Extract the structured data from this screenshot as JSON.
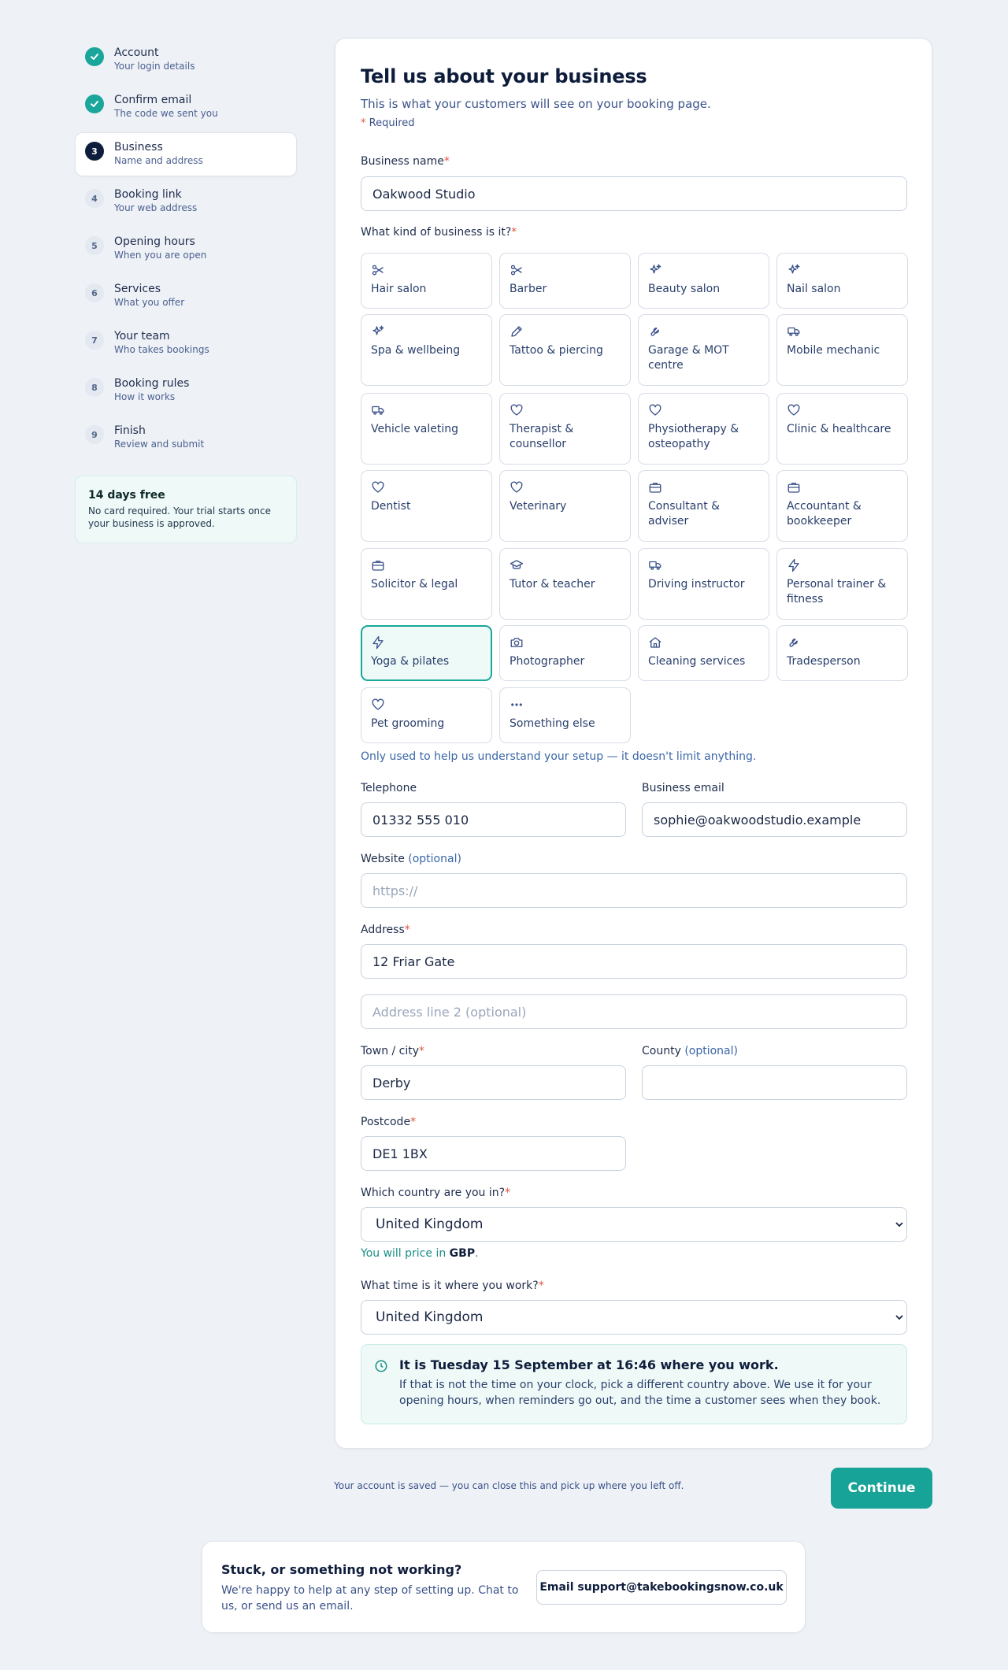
{
  "steps": [
    {
      "num": "",
      "title": "Account",
      "sub": "Your login details",
      "state": "done"
    },
    {
      "num": "",
      "title": "Confirm email",
      "sub": "The code we sent you",
      "state": "done"
    },
    {
      "num": "3",
      "title": "Business",
      "sub": "Name and address",
      "state": "current"
    },
    {
      "num": "4",
      "title": "Booking link",
      "sub": "Your web address",
      "state": "todo"
    },
    {
      "num": "5",
      "title": "Opening hours",
      "sub": "When you are open",
      "state": "todo"
    },
    {
      "num": "6",
      "title": "Services",
      "sub": "What you offer",
      "state": "todo"
    },
    {
      "num": "7",
      "title": "Your team",
      "sub": "Who takes bookings",
      "state": "todo"
    },
    {
      "num": "8",
      "title": "Booking rules",
      "sub": "How it works",
      "state": "todo"
    },
    {
      "num": "9",
      "title": "Finish",
      "sub": "Review and submit",
      "state": "todo"
    }
  ],
  "trial": {
    "title": "14 days free",
    "text": "No card required. Your trial starts once your business is approved."
  },
  "form": {
    "heading": "Tell us about your business",
    "intro": "This is what your customers will see on your booking page.",
    "required_star": "*",
    "required_note": "Required",
    "business_name": {
      "label": "Business name",
      "value": "Oakwood Studio"
    },
    "kind": {
      "label": "What kind of business is it?",
      "help": "Only used to help us understand your setup — it doesn't limit anything.",
      "selected": "Yoga & pilates",
      "options": [
        {
          "label": "Hair salon",
          "icon": "scissors-icon"
        },
        {
          "label": "Barber",
          "icon": "scissors-icon"
        },
        {
          "label": "Beauty salon",
          "icon": "sparkles-icon"
        },
        {
          "label": "Nail salon",
          "icon": "sparkles-icon"
        },
        {
          "label": "Spa & wellbeing",
          "icon": "sparkles-icon"
        },
        {
          "label": "Tattoo & piercing",
          "icon": "pen-icon"
        },
        {
          "label": "Garage & MOT centre",
          "icon": "wrench-icon"
        },
        {
          "label": "Mobile mechanic",
          "icon": "truck-icon"
        },
        {
          "label": "Vehicle valeting",
          "icon": "truck-icon"
        },
        {
          "label": "Therapist & counsellor",
          "icon": "heart-icon"
        },
        {
          "label": "Physiotherapy & osteopathy",
          "icon": "heart-icon"
        },
        {
          "label": "Clinic & healthcare",
          "icon": "heart-icon"
        },
        {
          "label": "Dentist",
          "icon": "heart-icon"
        },
        {
          "label": "Veterinary",
          "icon": "heart-icon"
        },
        {
          "label": "Consultant & adviser",
          "icon": "briefcase-icon"
        },
        {
          "label": "Accountant & bookkeeper",
          "icon": "briefcase-icon"
        },
        {
          "label": "Solicitor & legal",
          "icon": "briefcase-icon"
        },
        {
          "label": "Tutor & teacher",
          "icon": "graduation-cap-icon"
        },
        {
          "label": "Driving instructor",
          "icon": "truck-icon"
        },
        {
          "label": "Personal trainer & fitness",
          "icon": "lightning-icon"
        },
        {
          "label": "Yoga & pilates",
          "icon": "lightning-icon"
        },
        {
          "label": "Photographer",
          "icon": "camera-icon"
        },
        {
          "label": "Cleaning services",
          "icon": "home-icon"
        },
        {
          "label": "Tradesperson",
          "icon": "wrench-icon"
        },
        {
          "label": "Pet grooming",
          "icon": "heart-icon"
        },
        {
          "label": "Something else",
          "icon": "ellipsis-icon"
        }
      ]
    },
    "telephone": {
      "label": "Telephone",
      "value": "01332 555 010"
    },
    "email": {
      "label": "Business email",
      "value": "sophie@oakwoodstudio.example"
    },
    "website": {
      "label": "Website",
      "optional": "(optional)",
      "placeholder": "https://"
    },
    "address": {
      "label": "Address",
      "value": "12 Friar Gate",
      "line2_placeholder": "Address line 2 (optional)"
    },
    "town": {
      "label": "Town / city",
      "value": "Derby"
    },
    "county": {
      "label": "County",
      "optional": "(optional)",
      "value": ""
    },
    "postcode": {
      "label": "Postcode",
      "value": "DE1 1BX"
    },
    "country": {
      "label": "Which country are you in?",
      "value": "United Kingdom",
      "price_prefix": "You will price in",
      "currency": "GBP",
      "price_suffix": "."
    },
    "timezone": {
      "label": "What time is it where you work?",
      "value": "United Kingdom"
    },
    "time_info": {
      "title": "It is Tuesday 15 September at 16:46 where you work.",
      "text": "If that is not the time on your clock, pick a different country above. We use it for your opening hours, when reminders go out, and the time a customer sees when they book."
    }
  },
  "footer": {
    "saved": "Your account is saved — you can close this and pick up where you left off.",
    "continue": "Continue"
  },
  "help": {
    "title": "Stuck, or something not working?",
    "text": "We're happy to help at any step of setting up. Chat to us, or send us an email.",
    "email_button": "Email support@takebookingsnow.co.uk"
  },
  "colors": {
    "accent": "#17a397",
    "required": "#e2553f",
    "navy": "#0f1d3c"
  }
}
